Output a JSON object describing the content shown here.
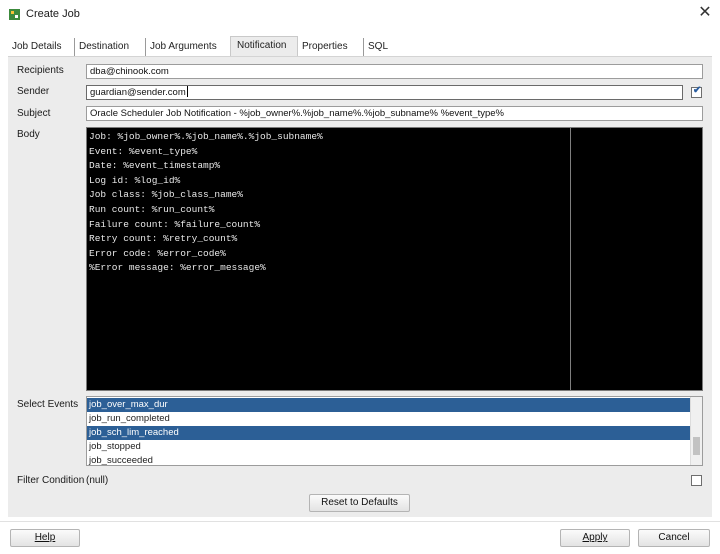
{
  "window": {
    "title": "Create Job",
    "close_glyph": "✕"
  },
  "tabs": [
    {
      "label": "Job Details"
    },
    {
      "label": "Destination"
    },
    {
      "label": "Job Arguments"
    },
    {
      "label": "Notification",
      "active": true
    },
    {
      "label": "Properties"
    },
    {
      "label": "SQL"
    }
  ],
  "form": {
    "recipients_label": "Recipients",
    "recipients_value": "dba@chinook.com",
    "sender_label": "Sender",
    "sender_value": "guardian@sender.com",
    "sender_checked": true,
    "subject_label": "Subject",
    "subject_value": "Oracle Scheduler Job Notification - %job_owner%.%job_name%.%job_subname% %event_type%",
    "body_label": "Body",
    "body_lines": [
      "Job: %job_owner%.%job_name%.%job_subname%",
      "Event: %event_type%",
      "Date: %event_timestamp%",
      "Log id: %log_id%",
      "Job class: %job_class_name%",
      "Run count: %run_count%",
      "Failure count: %failure_count%",
      "Retry count: %retry_count%",
      "Error code: %error_code%",
      "%Error message: %error_message%"
    ],
    "select_events_label": "Select Events",
    "events": [
      {
        "label": "job_over_max_dur",
        "selected": true
      },
      {
        "label": "job_run_completed",
        "selected": false
      },
      {
        "label": "job_sch_lim_reached",
        "selected": true
      },
      {
        "label": "job_stopped",
        "selected": false
      },
      {
        "label": "job_succeeded",
        "selected": false
      }
    ],
    "filter_label": "Filter Condition",
    "filter_value": "(null)",
    "filter_checked": false,
    "reset_label": "Reset to Defaults"
  },
  "footer": {
    "help_label": "Help",
    "apply_label": "Apply",
    "cancel_label": "Cancel"
  },
  "colors": {
    "selection": "#2c5f96",
    "editor_background": "#000000",
    "checkbox_mark": "#2a5d9f"
  }
}
